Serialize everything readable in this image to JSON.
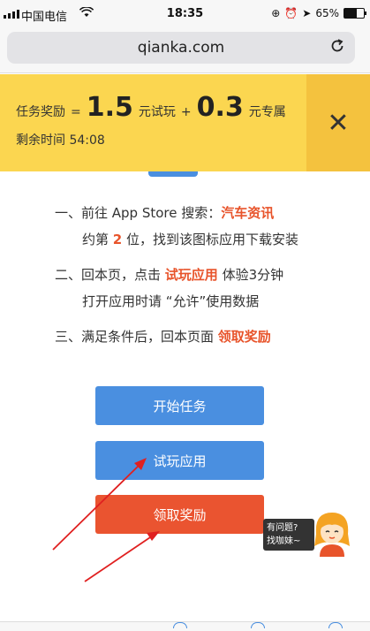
{
  "status_bar": {
    "carrier": "中国电信",
    "wifi_icon": "wifi-icon",
    "time": "18:35",
    "battery_percent": "65%",
    "battery_level": 0.65
  },
  "browser": {
    "url": "qianka.com",
    "reload_icon": "reload-icon"
  },
  "banner": {
    "label": "任务奖励",
    "equals": "=",
    "trial_amount": "1.5",
    "trial_unit": "元试玩",
    "plus": "+",
    "bonus_amount": "0.3",
    "bonus_unit": "元专属",
    "countdown_label": "剩余时间",
    "countdown_value": "54:08",
    "close_icon": "close-icon"
  },
  "steps": {
    "step1_prefix": "一、前往 App Store 搜索：",
    "step1_keyword": "汽车资讯",
    "step1_line2_prefix": "约第 ",
    "step1_rank": "2",
    "step1_line2_suffix": " 位，找到该图标应用下载安装",
    "step2_prefix": "二、回本页，点击 ",
    "step2_action": "试玩应用",
    "step2_suffix": " 体验3分钟",
    "step2_line2": "打开应用时请 “允许”使用数据",
    "step3_prefix": "三、满足条件后，回本页面 ",
    "step3_action": "领取奖励"
  },
  "buttons": {
    "start": "开始任务",
    "trial": "试玩应用",
    "claim": "领取奖励"
  },
  "help": {
    "line1": "有问题?",
    "line2": "找咖妹~"
  },
  "colors": {
    "banner_bg": "#fbd650",
    "primary_blue": "#4a8fe0",
    "accent_orange": "#ea5430",
    "annotation_red": "#e02020"
  }
}
